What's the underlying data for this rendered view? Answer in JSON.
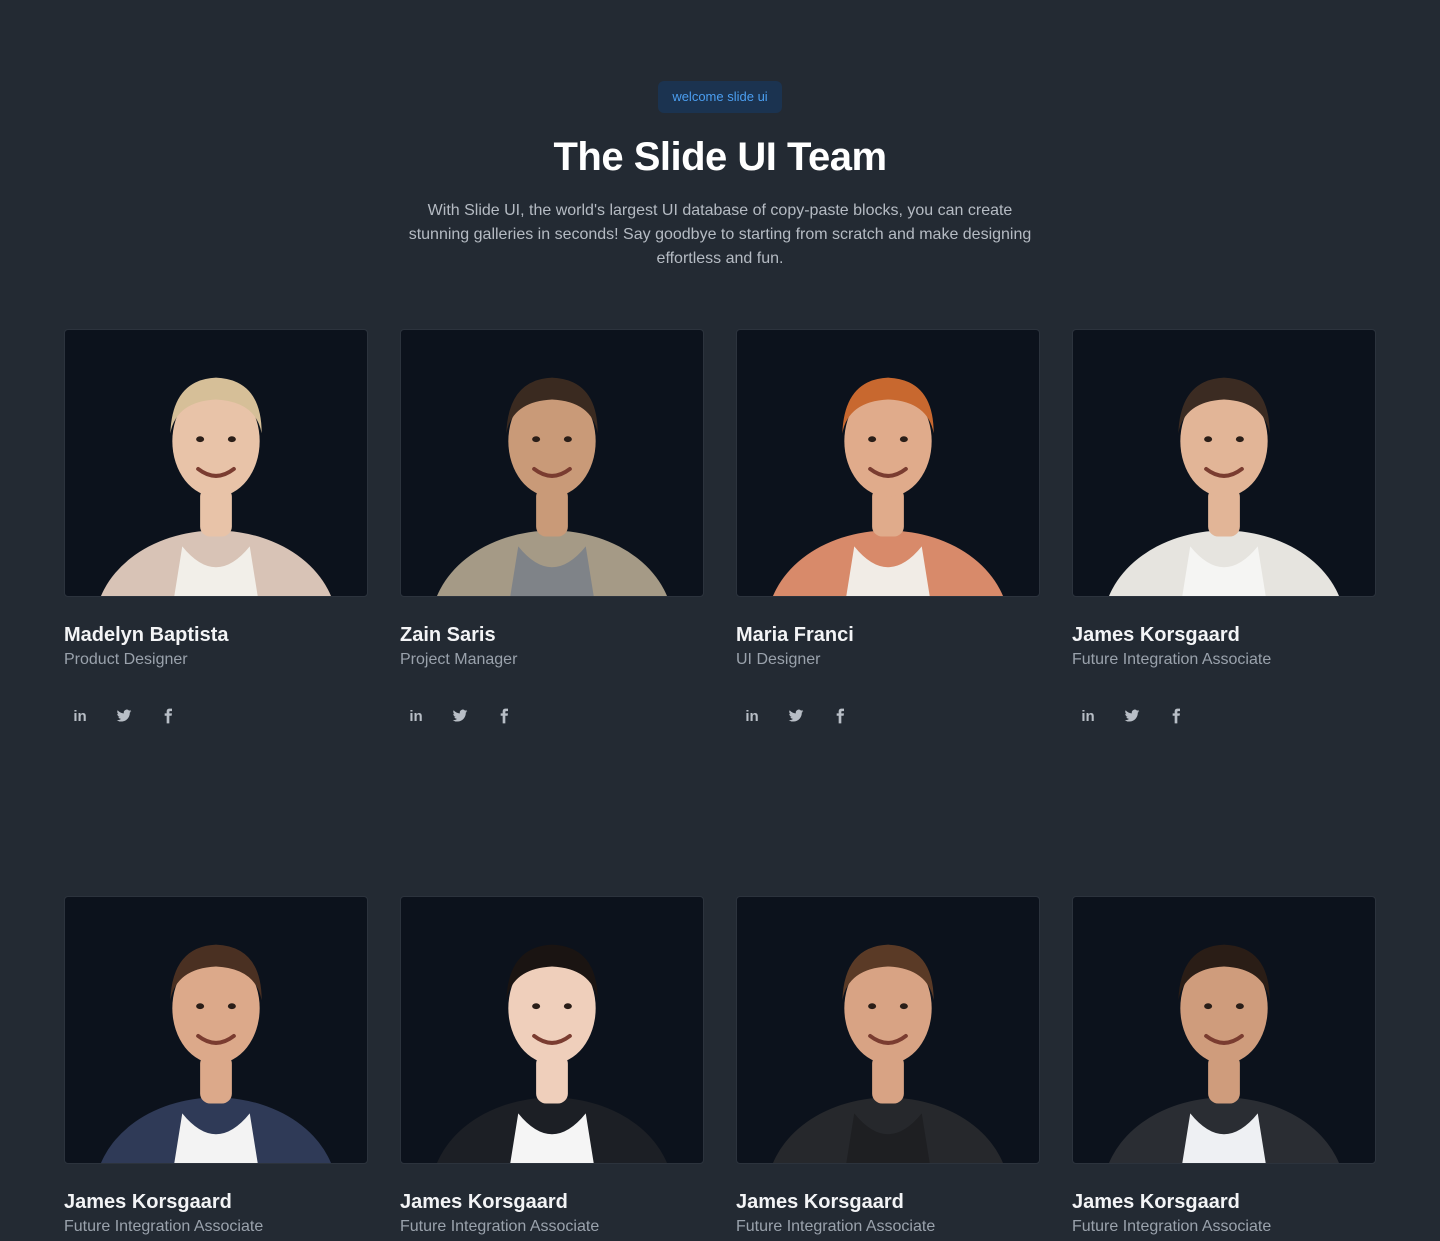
{
  "header": {
    "badge": "welcome slide ui",
    "title": "The Slide UI Team",
    "subtitle": "With Slide UI, the world's largest UI database of copy-paste blocks, you can create stunning galleries in seconds! Say goodbye to starting from scratch and make designing effortless and fun."
  },
  "social_icons": [
    "linkedin-icon",
    "twitter-icon",
    "facebook-icon"
  ],
  "social_labels": {
    "linkedin": "in"
  },
  "members": [
    {
      "name": "Madelyn Baptista",
      "role": "Product Designer",
      "skin": "#e8c3a8",
      "hair": "#d6bf98",
      "top": "#f2efe9",
      "jacket": "#d8c3b6"
    },
    {
      "name": "Zain Saris",
      "role": "Project Manager",
      "skin": "#c99a78",
      "hair": "#3a2a20",
      "top": "#7f8388",
      "jacket": "#a59a86"
    },
    {
      "name": "Maria Franci",
      "role": "UI Designer",
      "skin": "#e0ab8b",
      "hair": "#c8682f",
      "top": "#f1ece6",
      "jacket": "#d88a6a"
    },
    {
      "name": "James Korsgaard",
      "role": "Future Integration Associate",
      "skin": "#e2b597",
      "hair": "#3b2b22",
      "top": "#f5f5f3",
      "jacket": "#e6e4df"
    },
    {
      "name": "James Korsgaard",
      "role": "Future Integration Associate",
      "skin": "#dca98a",
      "hair": "#4a3022",
      "top": "#f3f3f3",
      "jacket": "#2f3a57"
    },
    {
      "name": "James Korsgaard",
      "role": "Future Integration Associate",
      "skin": "#efcfbb",
      "hair": "#1a1412",
      "top": "#f5f5f5",
      "jacket": "#1c1f25"
    },
    {
      "name": "James Korsgaard",
      "role": "Future Integration Associate",
      "skin": "#d8a384",
      "hair": "#5a3a26",
      "top": "#1e1f22",
      "jacket": "#26282c"
    },
    {
      "name": "James Korsgaard",
      "role": "Future Integration Associate",
      "skin": "#cf9c7c",
      "hair": "#2a1d16",
      "top": "#eef0f3",
      "jacket": "#2a2d33"
    }
  ]
}
